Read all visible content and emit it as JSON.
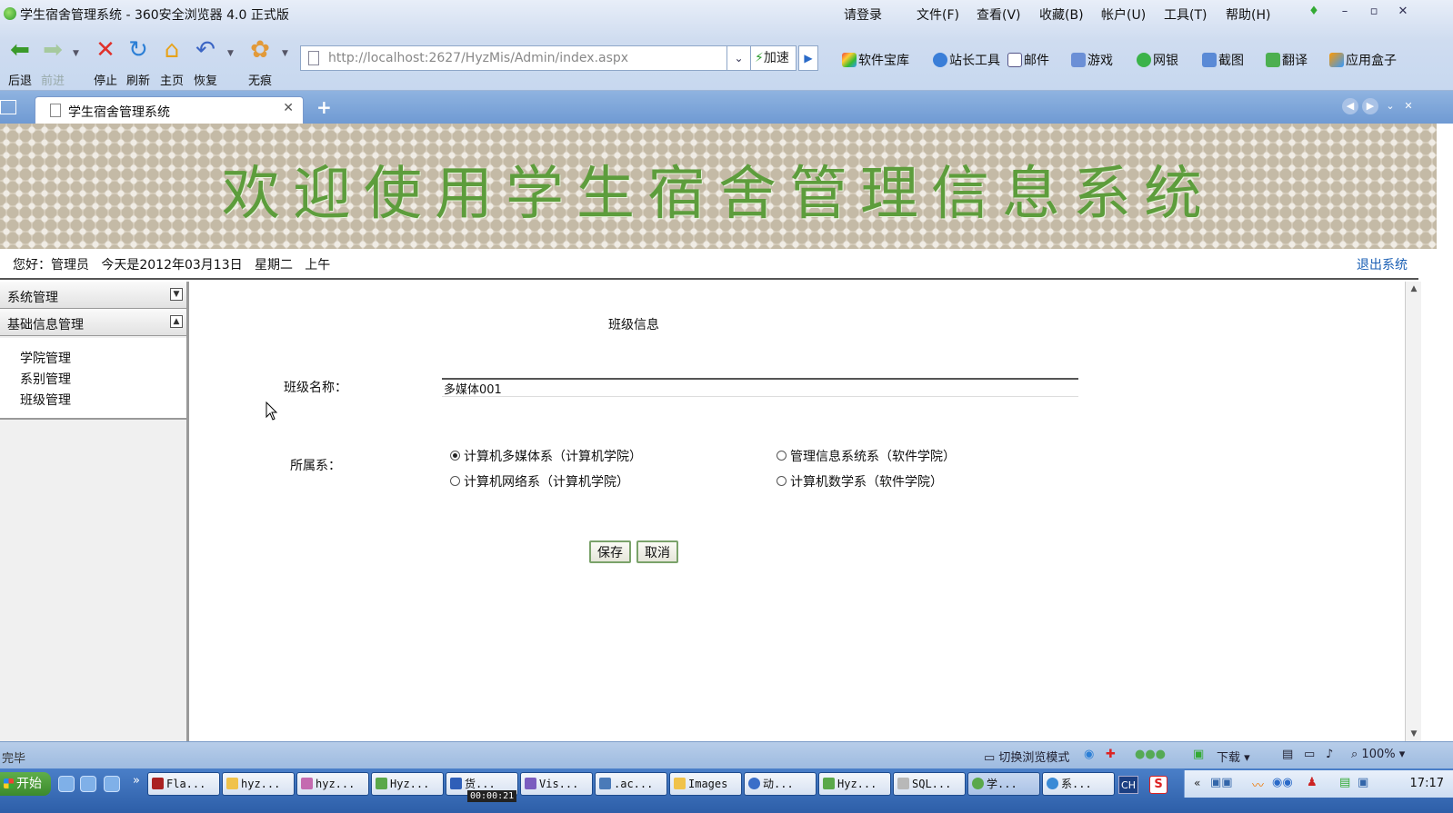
{
  "browser": {
    "window_title": "学生宿舍管理系统 - 360安全浏览器 4.0 正式版",
    "menu": [
      "请登录",
      "文件(F)",
      "查看(V)",
      "收藏(B)",
      "帐户(U)",
      "工具(T)",
      "帮助(H)"
    ],
    "toolbar": {
      "back": "后退",
      "forward": "前进",
      "stop": "停止",
      "refresh": "刷新",
      "home": "主页",
      "restore": "恢复",
      "incognito": "无痕"
    },
    "address": "http://localhost:2627/HyzMis/Admin/index.aspx",
    "accelerate": "加速",
    "tools": [
      "软件宝库",
      "站长工具",
      "邮件",
      "游戏",
      "网银",
      "截图",
      "翻译",
      "应用盒子"
    ],
    "tab_title": "学生宿舍管理系统",
    "status": "完毕",
    "status_right": {
      "switch_mode": "切换浏览模式",
      "download": "下载",
      "zoom": "100%"
    }
  },
  "page": {
    "banner_title": "欢迎使用学生宿舍管理信息系统",
    "greeting": "您好：管理员   今天是2012年03月13日   星期二   上午",
    "logout": "退出系统"
  },
  "nav": {
    "sections": [
      "系统管理",
      "基础信息管理"
    ],
    "items": [
      "学院管理",
      "系别管理",
      "班级管理"
    ]
  },
  "form": {
    "title": "班级信息",
    "class_name_label": "班级名称：",
    "class_name_value": "多媒体001",
    "dept_label": "所属系：",
    "options": [
      {
        "label": "计算机多媒体系（计算机学院）",
        "checked": true
      },
      {
        "label": "管理信息系统系（软件学院）",
        "checked": false
      },
      {
        "label": "计算机网络系（计算机学院）",
        "checked": false
      },
      {
        "label": "计算机数学系（软件学院）",
        "checked": false
      }
    ],
    "save": "保存",
    "cancel": "取消"
  },
  "taskbar": {
    "start": "开始",
    "tasks": [
      "Fla...",
      "hyz...",
      "hyz...",
      "Hyz...",
      "货...",
      "Vis...",
      ".ac...",
      "Images",
      "动...",
      "Hyz...",
      "SQL...",
      "学...",
      "系..."
    ],
    "ime": "CH",
    "clock": "17:17",
    "recording_timer": "00:00:21"
  },
  "colors": {
    "banner_text": "#5d9d3c",
    "link": "#1a5fb4",
    "button_border": "#7aa26a"
  }
}
